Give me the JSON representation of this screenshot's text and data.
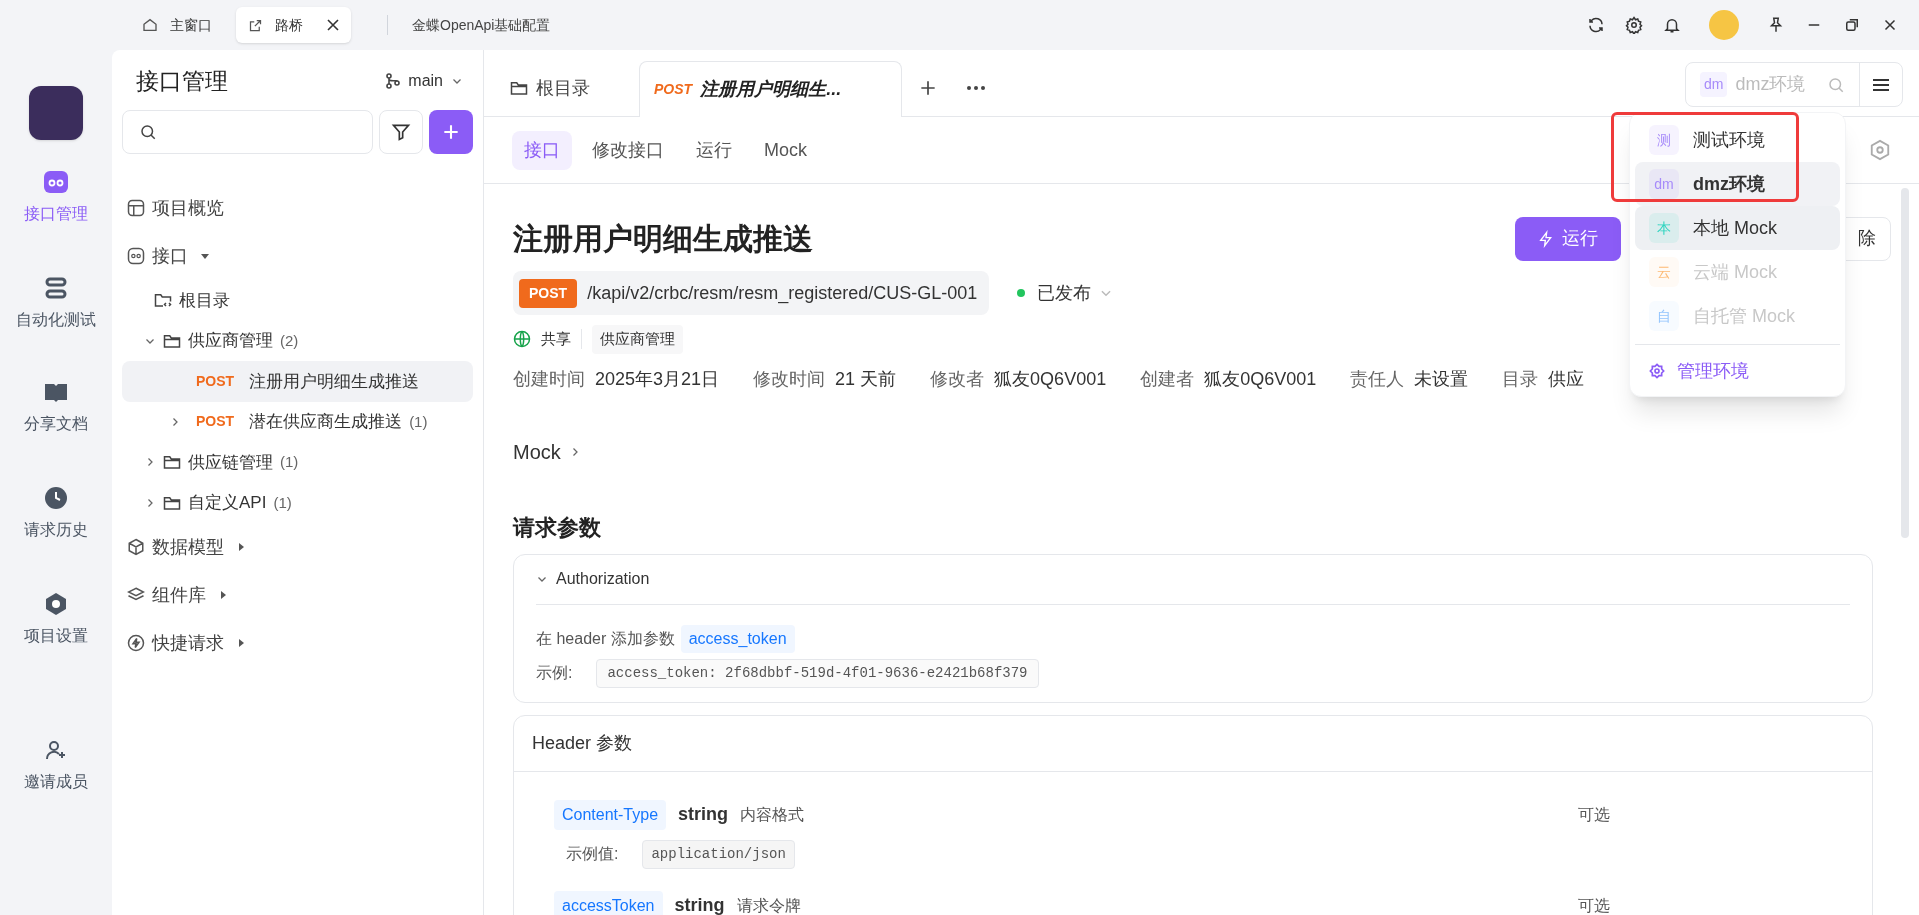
{
  "titlebar": {
    "tabs": [
      {
        "label": "主窗口",
        "selected": false,
        "closable": false
      },
      {
        "label": "路桥",
        "selected": true,
        "closable": true
      }
    ],
    "title": "金蝶OpenApi基础配置"
  },
  "nav_rail": {
    "items": [
      {
        "label": "接口管理",
        "selected": true
      },
      {
        "label": "自动化测试",
        "selected": false
      },
      {
        "label": "分享文档",
        "selected": false
      },
      {
        "label": "请求历史",
        "selected": false
      },
      {
        "label": "项目设置",
        "selected": false
      }
    ],
    "invite": "邀请成员"
  },
  "sidebar": {
    "title": "接口管理",
    "branch": "main",
    "tree": [
      {
        "kind": "overview",
        "label": "项目概览",
        "selected": false
      },
      {
        "kind": "api",
        "label": "接口",
        "expanded": true,
        "selected": false,
        "children": [
          {
            "kind": "root",
            "label": "根目录",
            "selected": false
          },
          {
            "kind": "folder",
            "label": "供应商管理",
            "count": "(2)",
            "expanded": true,
            "selected": false,
            "children": [
              {
                "kind": "endpoint",
                "method": "POST",
                "label": "注册用户明细生成推送",
                "selected": true
              },
              {
                "kind": "endpoint",
                "method": "POST",
                "label": "潜在供应商生成推送",
                "count": "(1)",
                "expanded": false,
                "selected": false
              }
            ]
          },
          {
            "kind": "folder",
            "label": "供应链管理",
            "count": "(1)",
            "expanded": false,
            "selected": false
          },
          {
            "kind": "folder",
            "label": "自定义API",
            "count": "(1)",
            "expanded": false,
            "selected": false
          }
        ]
      },
      {
        "kind": "models",
        "label": "数据模型",
        "expanded": false,
        "selected": false
      },
      {
        "kind": "components",
        "label": "组件库",
        "expanded": false,
        "selected": false
      },
      {
        "kind": "quick",
        "label": "快捷请求",
        "expanded": false,
        "selected": false
      }
    ]
  },
  "doc_tabs": [
    {
      "kind": "folder",
      "label": "根目录",
      "selected": false
    },
    {
      "kind": "endpoint",
      "method": "POST",
      "label": "注册用户明细生...",
      "selected": true
    }
  ],
  "sub_tabs": [
    {
      "label": "接口",
      "selected": true
    },
    {
      "label": "修改接口",
      "selected": false
    },
    {
      "label": "运行",
      "selected": false
    },
    {
      "label": "Mock",
      "selected": false
    }
  ],
  "env_selector": {
    "badge": "dm",
    "value": "dmz环境"
  },
  "env_menu": {
    "items": [
      {
        "badge": "测",
        "label": "测试环境",
        "color": "#a78bfa",
        "selected": false,
        "hovered": false,
        "disabled": false
      },
      {
        "badge": "dm",
        "label": "dmz环境",
        "color": "#a78bfa",
        "selected": true,
        "hovered": false,
        "disabled": false
      },
      {
        "badge": "本",
        "label": "本地 Mock",
        "color": "#2dd4bf",
        "selected": false,
        "hovered": true,
        "disabled": false
      },
      {
        "badge": "云",
        "label": "云端 Mock",
        "color": "#fdba74",
        "selected": false,
        "hovered": false,
        "disabled": true
      },
      {
        "badge": "自",
        "label": "自托管 Mock",
        "color": "#93c5fd",
        "selected": false,
        "hovered": false,
        "disabled": true
      }
    ],
    "footer": "管理环境"
  },
  "endpoint": {
    "title": "注册用户明细生成推送",
    "method": "POST",
    "path": "/kapi/v2/crbc/resm/resm_registered/CUS-GL-001",
    "status": "已发布",
    "share": "共享",
    "folder_tag": "供应商管理",
    "run_button": "运行",
    "delete_button": "除",
    "meta": [
      {
        "label": "创建时间",
        "value": "2025年3月21日"
      },
      {
        "label": "修改时间",
        "value": "21 天前"
      },
      {
        "label": "修改者",
        "value": "狐友0Q6V001"
      },
      {
        "label": "创建者",
        "value": "狐友0Q6V001"
      },
      {
        "label": "责任人",
        "value": "未设置"
      },
      {
        "label": "目录",
        "value": "供应"
      }
    ]
  },
  "mock_link": "Mock",
  "request_params": {
    "title": "请求参数",
    "auth": {
      "title": "Authorization",
      "expanded": true,
      "text": "在 header 添加参数",
      "param": "access_token",
      "example_label": "示例:",
      "example": "access_token: 2f68dbbf-519d-4f01-9636-e2421b68f379"
    },
    "header": {
      "title": "Header 参数",
      "params": [
        {
          "name": "Content-Type",
          "type": "string",
          "desc": "内容格式",
          "required": "可选",
          "example_label": "示例值:",
          "example": "application/json"
        },
        {
          "name": "accessToken",
          "type": "string",
          "desc": "请求令牌",
          "required": "可选"
        }
      ]
    }
  }
}
